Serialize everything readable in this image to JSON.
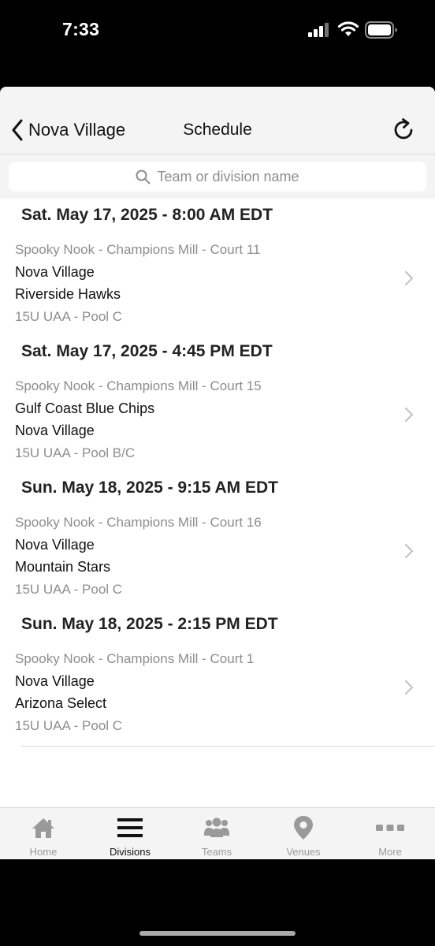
{
  "status_bar": {
    "time": "7:33"
  },
  "nav": {
    "back_label": "Nova Village",
    "title": "Schedule"
  },
  "search": {
    "placeholder": "Team or division name"
  },
  "schedule": [
    {
      "date": "Sat. May 17, 2025 - 8:00 AM EDT",
      "venue": "Spooky Nook - Champions Mill - Court 11",
      "team1": "Nova Village",
      "team2": "Riverside Hawks",
      "division": "15U UAA - Pool C"
    },
    {
      "date": "Sat. May 17, 2025 - 4:45 PM EDT",
      "venue": "Spooky Nook - Champions Mill - Court 15",
      "team1": "Gulf Coast Blue Chips",
      "team2": "Nova Village",
      "division": "15U UAA - Pool B/C"
    },
    {
      "date": "Sun. May 18, 2025 - 9:15 AM EDT",
      "venue": "Spooky Nook - Champions Mill - Court 16",
      "team1": "Nova Village",
      "team2": "Mountain Stars",
      "division": "15U UAA - Pool C"
    },
    {
      "date": "Sun. May 18, 2025 - 2:15 PM EDT",
      "venue": "Spooky Nook - Champions Mill - Court 1",
      "team1": "Nova Village",
      "team2": "Arizona Select",
      "division": "15U UAA - Pool C"
    }
  ],
  "tabs": [
    {
      "label": "Home",
      "icon": "home-icon",
      "active": false
    },
    {
      "label": "Divisions",
      "icon": "menu-icon",
      "active": true
    },
    {
      "label": "Teams",
      "icon": "people-icon",
      "active": false
    },
    {
      "label": "Venues",
      "icon": "location-pin-icon",
      "active": false
    },
    {
      "label": "More",
      "icon": "more-dots-icon",
      "active": false
    }
  ],
  "colors": {
    "active_tab": "#111111",
    "inactive_tab": "#9a9a9a",
    "secondary_text": "#8d8d8d"
  }
}
